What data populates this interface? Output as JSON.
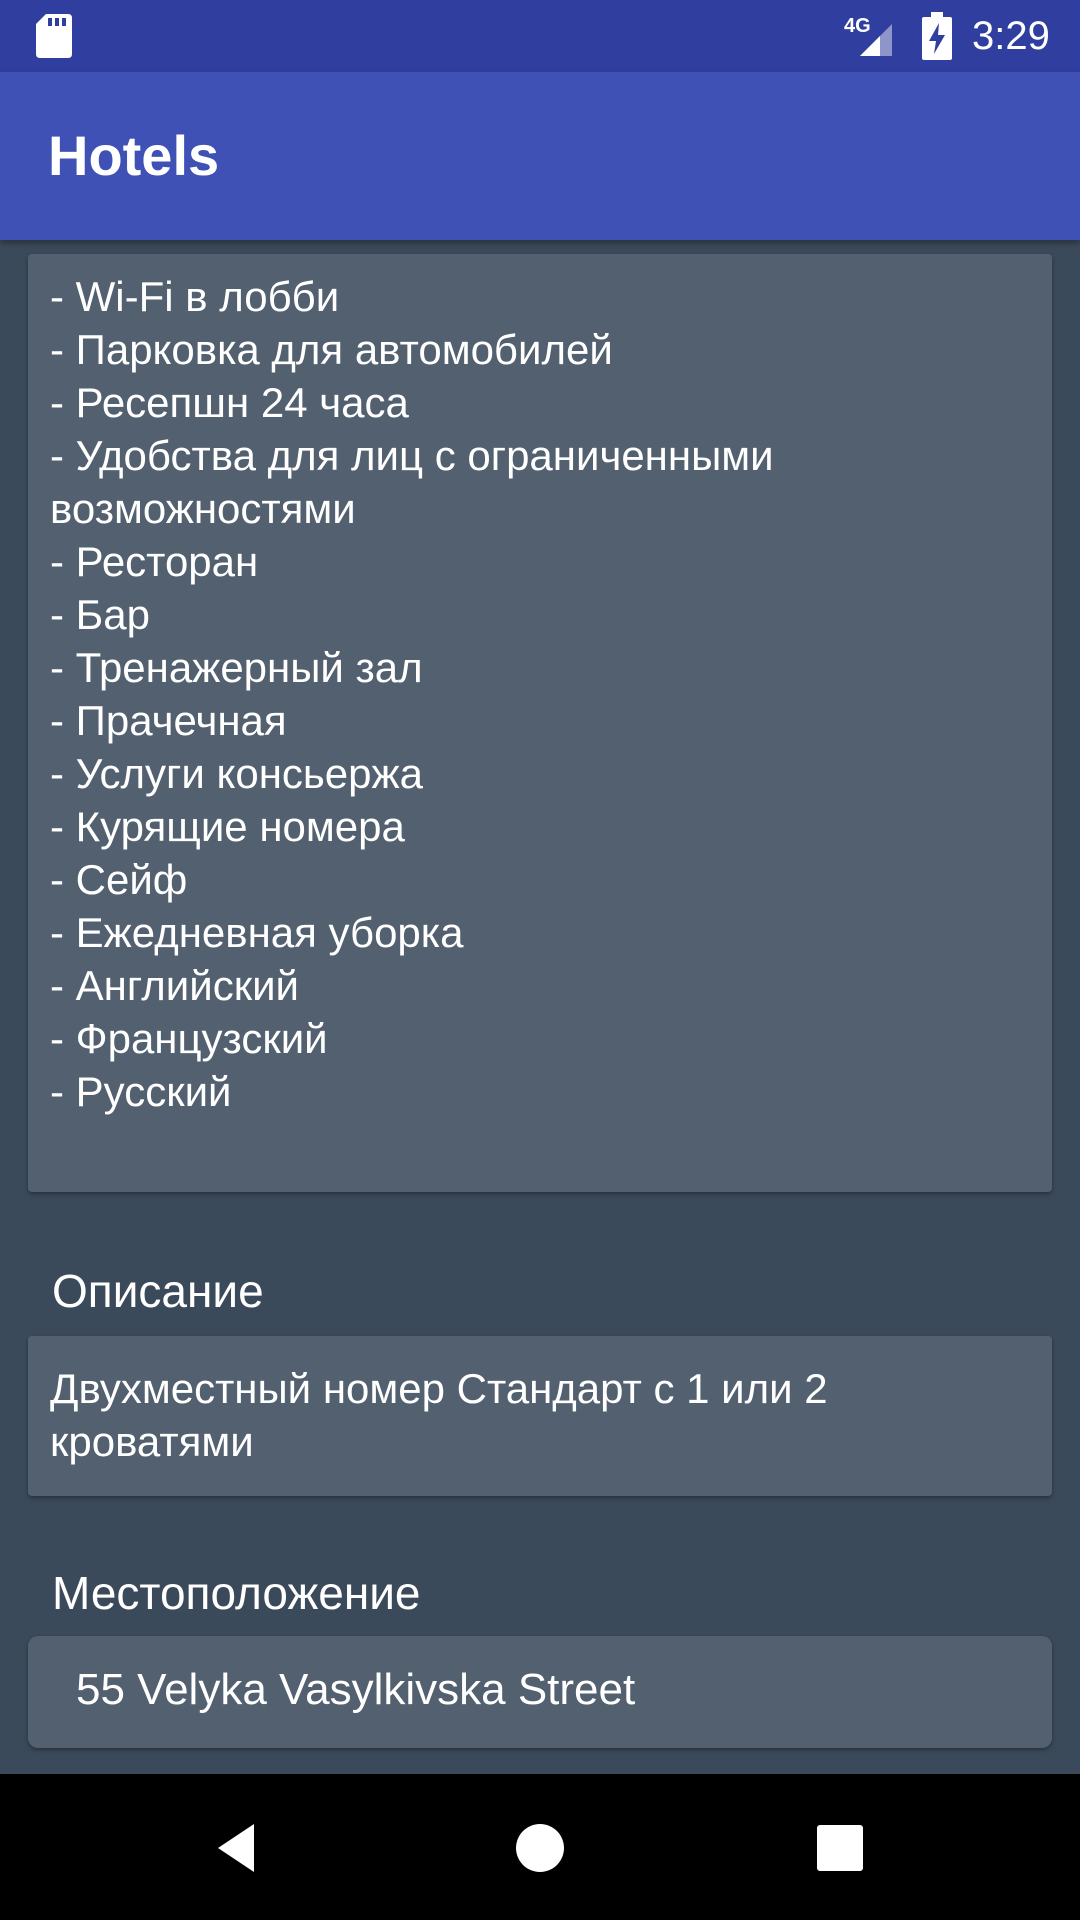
{
  "status_bar": {
    "time": "3:29",
    "network_label": "4G",
    "icons": [
      "sd-card-icon",
      "signal-icon",
      "battery-charging-icon"
    ]
  },
  "app_bar": {
    "title": "Hotels"
  },
  "facilities": {
    "items": [
      "- Wi-Fi в лобби",
      "- Парковка для автомобилей",
      "- Ресепшн 24 часа",
      "- Удобства для лиц с ограниченными возможностями",
      "- Ресторан",
      "- Бар",
      "- Тренажерный зал",
      "- Прачечная",
      "- Услуги консьержа",
      "- Курящие номера",
      "- Сейф",
      "- Ежедневная уборка",
      "- Английский",
      "- Французский",
      "- Русский"
    ]
  },
  "description": {
    "heading": "Описание",
    "text": "Двухместный номер Стандарт с 1 или 2 кроватями"
  },
  "location": {
    "heading": "Местоположение",
    "text": "55 Velyka Vasylkivska Street"
  },
  "nav_bar": {
    "icons": [
      "back-icon",
      "home-icon",
      "recents-icon"
    ]
  },
  "colors": {
    "status_bar": "#303f9f",
    "app_bar": "#3f51b5",
    "background": "#3b4a5a",
    "card": "#52606f",
    "nav_bar": "#000000"
  }
}
